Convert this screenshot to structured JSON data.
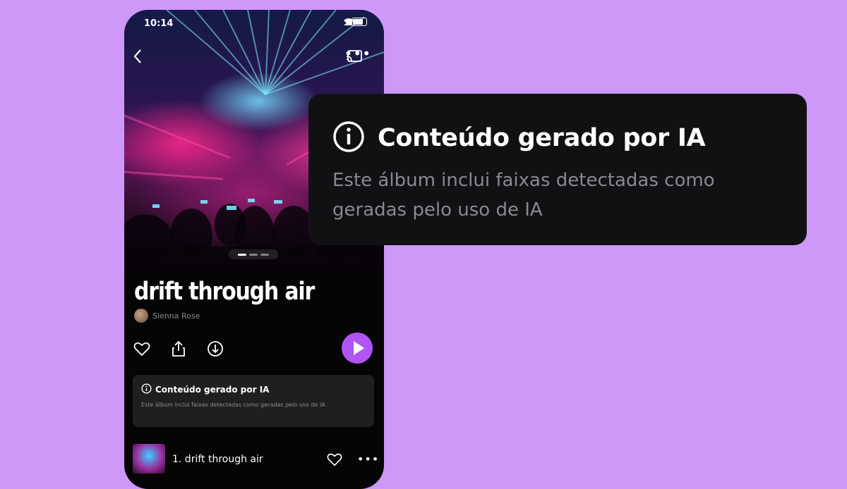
{
  "status_bar": {
    "time": "10:14"
  },
  "album": {
    "title": "drift through air",
    "artist": "Sienna Rose"
  },
  "ai_notice": {
    "title": "Conteúdo gerado por IA",
    "description": "Este álbum inclui faixas detectadas como geradas pelo uso de IA"
  },
  "tracks": [
    {
      "label": "1. drift through air"
    }
  ],
  "icons": {
    "back": "chevron-left-icon",
    "cast": "cast-icon",
    "more": "more-icon",
    "like": "heart-icon",
    "share": "share-icon",
    "download": "download-icon",
    "play": "play-icon",
    "info": "info-icon"
  },
  "colors": {
    "background": "#cd98f8",
    "accent": "#b154f5",
    "card": "#111113"
  }
}
